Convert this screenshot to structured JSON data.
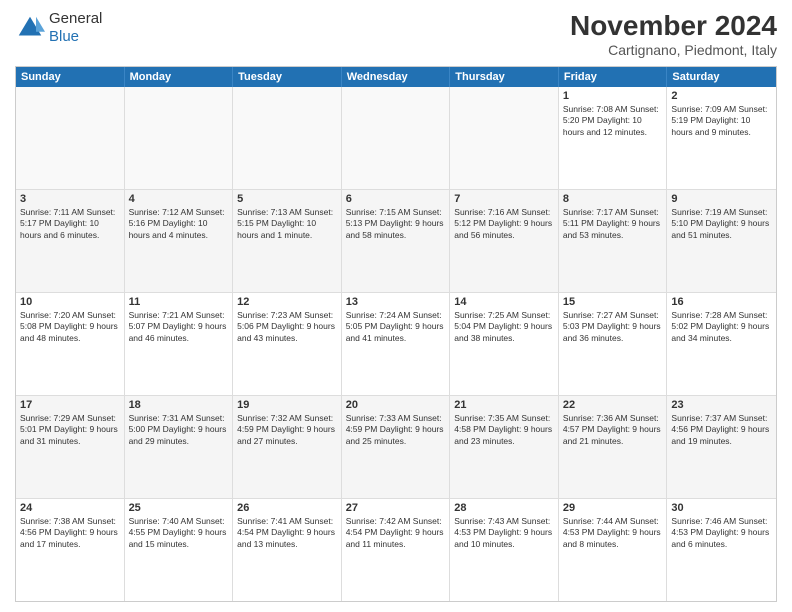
{
  "logo": {
    "line1": "General",
    "line2": "Blue"
  },
  "title": "November 2024",
  "location": "Cartignano, Piedmont, Italy",
  "header_days": [
    "Sunday",
    "Monday",
    "Tuesday",
    "Wednesday",
    "Thursday",
    "Friday",
    "Saturday"
  ],
  "rows": [
    [
      {
        "day": "",
        "text": ""
      },
      {
        "day": "",
        "text": ""
      },
      {
        "day": "",
        "text": ""
      },
      {
        "day": "",
        "text": ""
      },
      {
        "day": "",
        "text": ""
      },
      {
        "day": "1",
        "text": "Sunrise: 7:08 AM\nSunset: 5:20 PM\nDaylight: 10 hours and 12 minutes."
      },
      {
        "day": "2",
        "text": "Sunrise: 7:09 AM\nSunset: 5:19 PM\nDaylight: 10 hours and 9 minutes."
      }
    ],
    [
      {
        "day": "3",
        "text": "Sunrise: 7:11 AM\nSunset: 5:17 PM\nDaylight: 10 hours and 6 minutes."
      },
      {
        "day": "4",
        "text": "Sunrise: 7:12 AM\nSunset: 5:16 PM\nDaylight: 10 hours and 4 minutes."
      },
      {
        "day": "5",
        "text": "Sunrise: 7:13 AM\nSunset: 5:15 PM\nDaylight: 10 hours and 1 minute."
      },
      {
        "day": "6",
        "text": "Sunrise: 7:15 AM\nSunset: 5:13 PM\nDaylight: 9 hours and 58 minutes."
      },
      {
        "day": "7",
        "text": "Sunrise: 7:16 AM\nSunset: 5:12 PM\nDaylight: 9 hours and 56 minutes."
      },
      {
        "day": "8",
        "text": "Sunrise: 7:17 AM\nSunset: 5:11 PM\nDaylight: 9 hours and 53 minutes."
      },
      {
        "day": "9",
        "text": "Sunrise: 7:19 AM\nSunset: 5:10 PM\nDaylight: 9 hours and 51 minutes."
      }
    ],
    [
      {
        "day": "10",
        "text": "Sunrise: 7:20 AM\nSunset: 5:08 PM\nDaylight: 9 hours and 48 minutes."
      },
      {
        "day": "11",
        "text": "Sunrise: 7:21 AM\nSunset: 5:07 PM\nDaylight: 9 hours and 46 minutes."
      },
      {
        "day": "12",
        "text": "Sunrise: 7:23 AM\nSunset: 5:06 PM\nDaylight: 9 hours and 43 minutes."
      },
      {
        "day": "13",
        "text": "Sunrise: 7:24 AM\nSunset: 5:05 PM\nDaylight: 9 hours and 41 minutes."
      },
      {
        "day": "14",
        "text": "Sunrise: 7:25 AM\nSunset: 5:04 PM\nDaylight: 9 hours and 38 minutes."
      },
      {
        "day": "15",
        "text": "Sunrise: 7:27 AM\nSunset: 5:03 PM\nDaylight: 9 hours and 36 minutes."
      },
      {
        "day": "16",
        "text": "Sunrise: 7:28 AM\nSunset: 5:02 PM\nDaylight: 9 hours and 34 minutes."
      }
    ],
    [
      {
        "day": "17",
        "text": "Sunrise: 7:29 AM\nSunset: 5:01 PM\nDaylight: 9 hours and 31 minutes."
      },
      {
        "day": "18",
        "text": "Sunrise: 7:31 AM\nSunset: 5:00 PM\nDaylight: 9 hours and 29 minutes."
      },
      {
        "day": "19",
        "text": "Sunrise: 7:32 AM\nSunset: 4:59 PM\nDaylight: 9 hours and 27 minutes."
      },
      {
        "day": "20",
        "text": "Sunrise: 7:33 AM\nSunset: 4:59 PM\nDaylight: 9 hours and 25 minutes."
      },
      {
        "day": "21",
        "text": "Sunrise: 7:35 AM\nSunset: 4:58 PM\nDaylight: 9 hours and 23 minutes."
      },
      {
        "day": "22",
        "text": "Sunrise: 7:36 AM\nSunset: 4:57 PM\nDaylight: 9 hours and 21 minutes."
      },
      {
        "day": "23",
        "text": "Sunrise: 7:37 AM\nSunset: 4:56 PM\nDaylight: 9 hours and 19 minutes."
      }
    ],
    [
      {
        "day": "24",
        "text": "Sunrise: 7:38 AM\nSunset: 4:56 PM\nDaylight: 9 hours and 17 minutes."
      },
      {
        "day": "25",
        "text": "Sunrise: 7:40 AM\nSunset: 4:55 PM\nDaylight: 9 hours and 15 minutes."
      },
      {
        "day": "26",
        "text": "Sunrise: 7:41 AM\nSunset: 4:54 PM\nDaylight: 9 hours and 13 minutes."
      },
      {
        "day": "27",
        "text": "Sunrise: 7:42 AM\nSunset: 4:54 PM\nDaylight: 9 hours and 11 minutes."
      },
      {
        "day": "28",
        "text": "Sunrise: 7:43 AM\nSunset: 4:53 PM\nDaylight: 9 hours and 10 minutes."
      },
      {
        "day": "29",
        "text": "Sunrise: 7:44 AM\nSunset: 4:53 PM\nDaylight: 9 hours and 8 minutes."
      },
      {
        "day": "30",
        "text": "Sunrise: 7:46 AM\nSunset: 4:53 PM\nDaylight: 9 hours and 6 minutes."
      }
    ]
  ]
}
